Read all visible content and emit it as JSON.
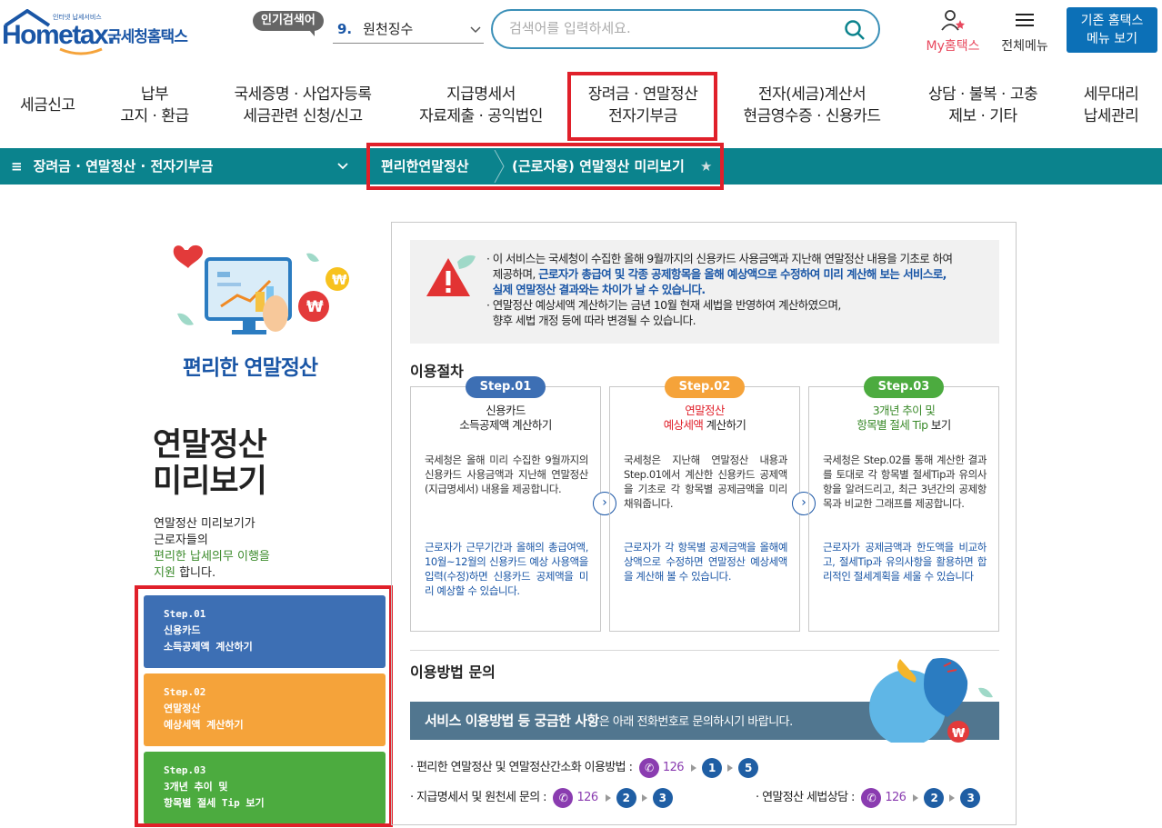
{
  "header": {
    "logo_text": "Hometax.",
    "logo_kor": "국세청홈택스",
    "logo_tiny": "인터넷 납세서비스",
    "popular_label": "인기검색어",
    "popular_rank": "9.",
    "popular_term": "원천징수",
    "search_placeholder": "검색어를 입력하세요.",
    "my_hometax": "My홈택스",
    "all_menu": "전체메뉴",
    "old_hometax_line1": "기존 홈택스",
    "old_hometax_line2": "메뉴 보기"
  },
  "mainnav": [
    {
      "l1": "세금신고",
      "l2": ""
    },
    {
      "l1": "납부",
      "l2": "고지 · 환급"
    },
    {
      "l1": "국세증명 · 사업자등록",
      "l2": "세금관련 신청/신고"
    },
    {
      "l1": "지급명세서",
      "l2": "자료제출 · 공익법인"
    },
    {
      "l1": "장려금 · 연말정산",
      "l2": "전자기부금"
    },
    {
      "l1": "전자(세금)계산서",
      "l2": "현금영수증 · 신용카드"
    },
    {
      "l1": "상담 · 불복 · 고충",
      "l2": "제보 · 기타"
    },
    {
      "l1": "세무대리",
      "l2": "납세관리"
    }
  ],
  "breadcrumb": {
    "menu": "장려금 · 연말정산 · 전자기부금",
    "level1": "편리한연말정산",
    "level2": "(근로자용) 연말정산 미리보기"
  },
  "left": {
    "illus_title": "편리한 연말정산",
    "big_title_1": "연말정산",
    "big_title_2": "미리보기",
    "desc_1": "연말정산 미리보기가",
    "desc_2": "근로자들의",
    "desc_3": "편리한 납세의무 이행을",
    "desc_4": "지원",
    "desc_5": "합니다.",
    "steps": [
      {
        "line1": "Step.01",
        "line2": "신용카드",
        "line3": "소득공제액 계산하기",
        "color": "#3d6fb4"
      },
      {
        "line1": "Step.02",
        "line2": "연말정산",
        "line3": "예상세액 계산하기",
        "color": "#f5a33a"
      },
      {
        "line1": "Step.03",
        "line2": "3개년 추이 및",
        "line3": "항목별 절세 Tip 보기",
        "color": "#4cab3f"
      }
    ]
  },
  "notice": {
    "p1_a": "· 이 서비스는 국세청이 수집한 올해 9월까지의 신용카드 사용금액과 지난해 연말정산 내용을 기초로 하여",
    "p1_b": "제공하며,",
    "p1_c": "근로자가 총급여 및 각종 공제항목을 올해 예상액으로 수정하여 미리 계산해 보는 서비스로,",
    "p1_d": "실제 연말정산 결과와는 차이가 날 수 있습니다.",
    "p2_a": "· 연말정산 예상세액 계산하기는 금년 10월 현재 세법을 반영하여 계산하였으며,",
    "p2_b": "향후 세법 개정 등에 따라 변경될 수 있습니다."
  },
  "procedure": {
    "title": "이용절차",
    "cards": [
      {
        "pill": "Step.01",
        "pill_color": "#3d6fb4",
        "head1": "신용카드",
        "head2": "소득공제액 계산하기",
        "body": "국세청은 올해 미리 수집한 9월까지의 신용카드 사용금액과 지난해 연말정산(지급명세서) 내용을 제공합니다.",
        "note": "근로자가 근무기간과 올해의 총급여액, 10월~12월의 신용카드 예상 사용액을 입력(수정)하면 신용카드 공제액을 미리 예상할 수 있습니다."
      },
      {
        "pill": "Step.02",
        "pill_color": "#f5a33a",
        "head1": "연말정산",
        "head2a": "예상세액",
        "head2b": " 계산하기",
        "body": "국세청은 지난해 연말정산 내용과 Step.01에서 계산한 신용카드 공제액을 기초로 각 항목별 공제금액을 미리 채워줍니다.",
        "note": "근로자가 각 항목별 공제금액을 올해예상액으로 수정하면 연말정산 예상세액을 계산해 볼 수 있습니다."
      },
      {
        "pill": "Step.03",
        "pill_color": "#4cab3f",
        "head1": "3개년 추이 및",
        "head2a": "항목별 절세 Tip",
        "head2b": " 보기",
        "body": "국세청은 Step.02를 통해 계산한 결과를 토대로 각 항목별 절세Tip과 유의사항을 알려드리고, 최근 3년간의 공제항목과 비교한 그래프를 제공합니다.",
        "note": "근로자가 공제금액과 한도액을 비교하고, 절세Tip과 유의사항을 활용하면 합리적인 절세계획을 세울 수 있습니다"
      }
    ]
  },
  "contact": {
    "title": "이용방법 문의",
    "bar_bold": "서비스 이용방법 등 궁금한 사항",
    "bar_rest": "은 아래 전화번호로 문의하시기 바랍니다.",
    "row1_label": "· 편리한 연말정산 및 연말정산간소화 이용방법 :",
    "row2_label": "· 지급명세서 및 원천세 문의 :",
    "row3_label": "· 연말정산 세법상담 :",
    "phone": "126",
    "row1_nums": [
      "1",
      "5"
    ],
    "row2_nums": [
      "2",
      "3"
    ],
    "row3_nums": [
      "2",
      "3"
    ]
  }
}
